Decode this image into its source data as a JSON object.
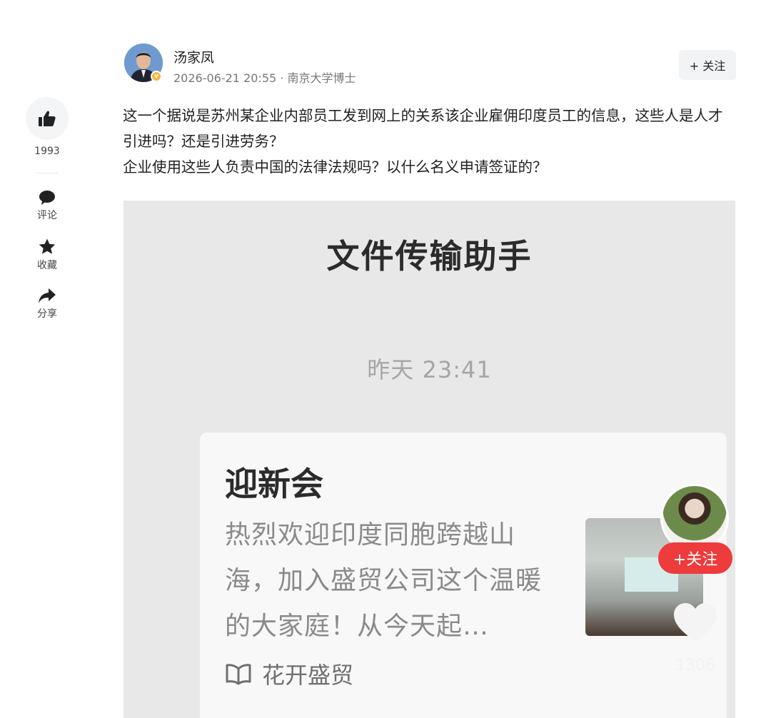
{
  "rail": {
    "like_count": "1993",
    "comment_label": "评论",
    "favorite_label": "收藏",
    "share_label": "分享"
  },
  "author": {
    "name": "汤家凤",
    "meta": "2026-06-21 20:55 · 南京大学博士",
    "follow_label": "+ 关注",
    "verified_mark": "v"
  },
  "post": {
    "paragraphs": [
      "这一个据说是苏州某企业内部员工发到网上的关系该企业雇佣印度员工的信息，这些人是人才引进吗？还是引进劳务？",
      "企业使用这些人负责中国的法律法规吗？以什么名义申请签证的？"
    ]
  },
  "embedded": {
    "chat_title": "文件传输助手",
    "chat_time": "昨天 23:41",
    "card_title": "迎新会",
    "card_desc": "热烈欢迎印度同胞跨越山海，加入盛贸公司这个温暖的大家庭！从今天起…",
    "card_source": "花开盛贸",
    "overlay_follow": "+关注",
    "overlay_count": "1306"
  },
  "icons": {
    "like": "thumbs-up-icon",
    "comment": "comment-bubble-icon",
    "favorite": "star-icon",
    "share": "share-arrow-icon",
    "source": "book-icon",
    "heart": "heart-icon"
  },
  "colors": {
    "follow_red": "#ee3b3b",
    "verified_gold": "#f3b742"
  }
}
